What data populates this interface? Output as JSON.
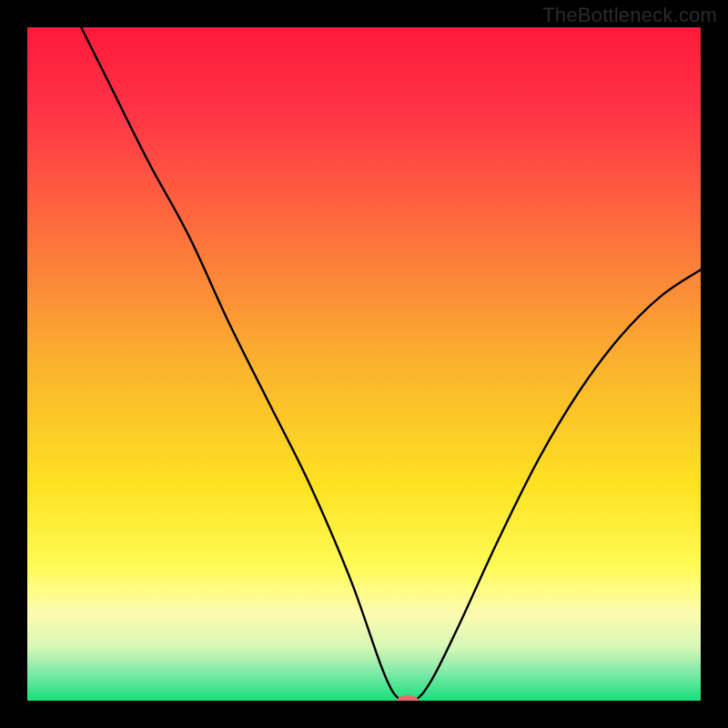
{
  "watermark": "TheBottleneck.com",
  "chart_data": {
    "type": "line",
    "title": "",
    "xlabel": "",
    "ylabel": "",
    "xlim": [
      0,
      1
    ],
    "ylim": [
      0,
      1
    ],
    "background_gradient": {
      "stops": [
        {
          "offset": 0.0,
          "color": "#ff1a3a"
        },
        {
          "offset": 0.12,
          "color": "#ff3246"
        },
        {
          "offset": 0.3,
          "color": "#fd6e3e"
        },
        {
          "offset": 0.5,
          "color": "#fbb22f"
        },
        {
          "offset": 0.68,
          "color": "#fde221"
        },
        {
          "offset": 0.8,
          "color": "#fffb55"
        },
        {
          "offset": 0.87,
          "color": "#fcfcb0"
        },
        {
          "offset": 0.92,
          "color": "#d8f7b6"
        },
        {
          "offset": 0.96,
          "color": "#7be9a8"
        },
        {
          "offset": 1.0,
          "color": "#18e07a"
        }
      ]
    },
    "series": [
      {
        "name": "bottleneck-curve",
        "color": "#000000",
        "x": [
          0.08,
          0.12,
          0.18,
          0.24,
          0.3,
          0.36,
          0.42,
          0.48,
          0.53,
          0.555,
          0.575,
          0.6,
          0.64,
          0.7,
          0.76,
          0.82,
          0.88,
          0.94,
          1.0
        ],
        "y": [
          1.0,
          0.92,
          0.8,
          0.69,
          0.56,
          0.44,
          0.32,
          0.18,
          0.04,
          0.0,
          0.0,
          0.03,
          0.11,
          0.24,
          0.36,
          0.46,
          0.54,
          0.6,
          0.64
        ]
      }
    ],
    "marker": {
      "name": "current-point",
      "x": 0.565,
      "y": 0.0,
      "color": "#e96a6a",
      "rx": 12,
      "ry": 6
    }
  }
}
